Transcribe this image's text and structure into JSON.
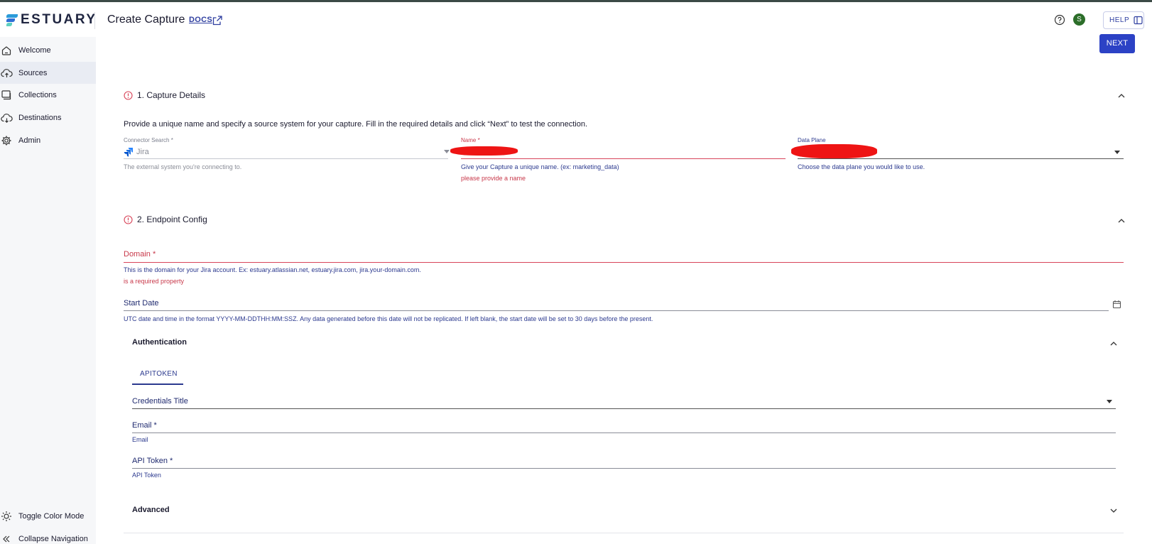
{
  "header": {
    "logo_text": "ESTUARY",
    "page_title": "Create Capture",
    "docs_label": "DOCS",
    "avatar_initial": "S",
    "help_label": "HELP"
  },
  "sidebar": {
    "items": [
      {
        "label": "Welcome",
        "icon": "home-icon"
      },
      {
        "label": "Sources",
        "icon": "cloud-upload-icon"
      },
      {
        "label": "Collections",
        "icon": "collections-icon"
      },
      {
        "label": "Destinations",
        "icon": "cloud-download-icon"
      },
      {
        "label": "Admin",
        "icon": "gear-icon"
      }
    ],
    "bottom": [
      {
        "label": "Toggle Color Mode",
        "icon": "sun-icon"
      },
      {
        "label": "Collapse Navigation",
        "icon": "double-chevron-left-icon"
      }
    ]
  },
  "actions": {
    "next_label": "NEXT"
  },
  "capture_details": {
    "title": "1. Capture Details",
    "description": "Provide a unique name and specify a source system for your capture. Fill in the required details and click “Next” to test the connection.",
    "connector": {
      "label": "Connector Search *",
      "value": "Jira",
      "helper": "The external system you're connecting to."
    },
    "name": {
      "label": "Name *",
      "helper": "Give your Capture a unique name. (ex: marketing_data)",
      "error": "please provide a name"
    },
    "data_plane": {
      "label": "Data Plane",
      "helper": "Choose the data plane you would like to use."
    }
  },
  "endpoint_config": {
    "title": "2. Endpoint Config",
    "domain": {
      "label": "Domain *",
      "helper": "This is the domain for your Jira account. Ex: estuary.atlassian.net, estuary.jira.com, jira.your-domain.com.",
      "error": "is a required property"
    },
    "start_date": {
      "label": "Start Date",
      "helper": "UTC date and time in the format YYYY-MM-DDTHH:MM:SSZ. Any data generated before this date will not be replicated. If left blank, the start date will be set to 30 days before the present."
    },
    "authentication": {
      "title": "Authentication",
      "tab_label": "APITOKEN",
      "credentials_title": "Credentials Title",
      "email": {
        "label": "Email *",
        "helper": "Email"
      },
      "api_token": {
        "label": "API Token *",
        "helper": "API Token"
      }
    },
    "advanced": {
      "title": "Advanced"
    }
  },
  "colors": {
    "primary": "#2c42c5",
    "error": "#d8455a",
    "link": "#2f3fa0",
    "sidebar_bg": "#f6f7f9"
  }
}
